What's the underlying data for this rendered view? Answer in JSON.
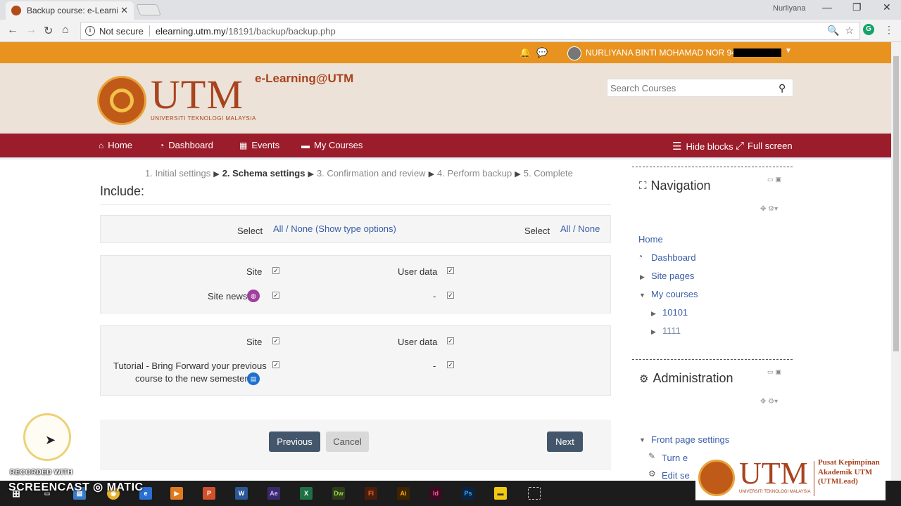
{
  "browser": {
    "tab_title": "Backup course: e-Learnin",
    "window_user": "Nurliyana",
    "security_label": "Not secure",
    "url_host": "elearning.utm.my",
    "url_path": "/18191/backup/backup.php"
  },
  "topbar": {
    "user_name": "NURLIYANA BINTI MOHAMAD NOR 94"
  },
  "header": {
    "logo_text": "UTM",
    "logo_subtitle": "UNIVERSITI TEKNOLOGI MALAYSIA",
    "site_name": "e-Learning@UTM",
    "search_placeholder": "Search Courses"
  },
  "navbar": {
    "items": [
      {
        "label": "Home",
        "icon": "home-icon"
      },
      {
        "label": "Dashboard",
        "icon": "dashboard-icon"
      },
      {
        "label": "Events",
        "icon": "calendar-icon"
      },
      {
        "label": "My Courses",
        "icon": "briefcase-icon"
      }
    ],
    "hide_blocks": "Hide blocks",
    "full_screen": "Full screen"
  },
  "steps": {
    "s1": "1. Initial settings",
    "s2": "2. Schema settings",
    "s3": "3. Confirmation and review",
    "s4": "4. Perform backup",
    "s5": "5. Complete"
  },
  "main": {
    "include_title": "Include:",
    "select_label": "Select",
    "select_left_link": "All / None (Show type options)",
    "select_right_link": "All / None",
    "section1": {
      "site_label": "Site",
      "user_data_label": "User data",
      "item_label": "Site news",
      "dash": "-"
    },
    "section2": {
      "site_label": "Site",
      "user_data_label": "User data",
      "item_label_line1": "Tutorial - Bring Forward your previous",
      "item_label_line2": "course to the new semester!",
      "dash": "-"
    },
    "buttons": {
      "previous": "Previous",
      "cancel": "Cancel",
      "next": "Next"
    }
  },
  "sidebar": {
    "navigation": {
      "title": "Navigation",
      "items": {
        "home": "Home",
        "dashboard": "Dashboard",
        "site_pages": "Site pages",
        "my_courses": "My courses",
        "course1": "10101",
        "course2": "1111"
      }
    },
    "administration": {
      "title": "Administration",
      "front_page_settings": "Front page settings",
      "turn_editing": "Turn e",
      "edit_settings": "Edit se"
    }
  },
  "overlay": {
    "recorded_with": "RECORDED WITH",
    "screencast": "SCREENCAST",
    "matic": "MATIC",
    "watermark_text": "Pusat Kepimpinan Akademik UTM (UTMLead)"
  }
}
